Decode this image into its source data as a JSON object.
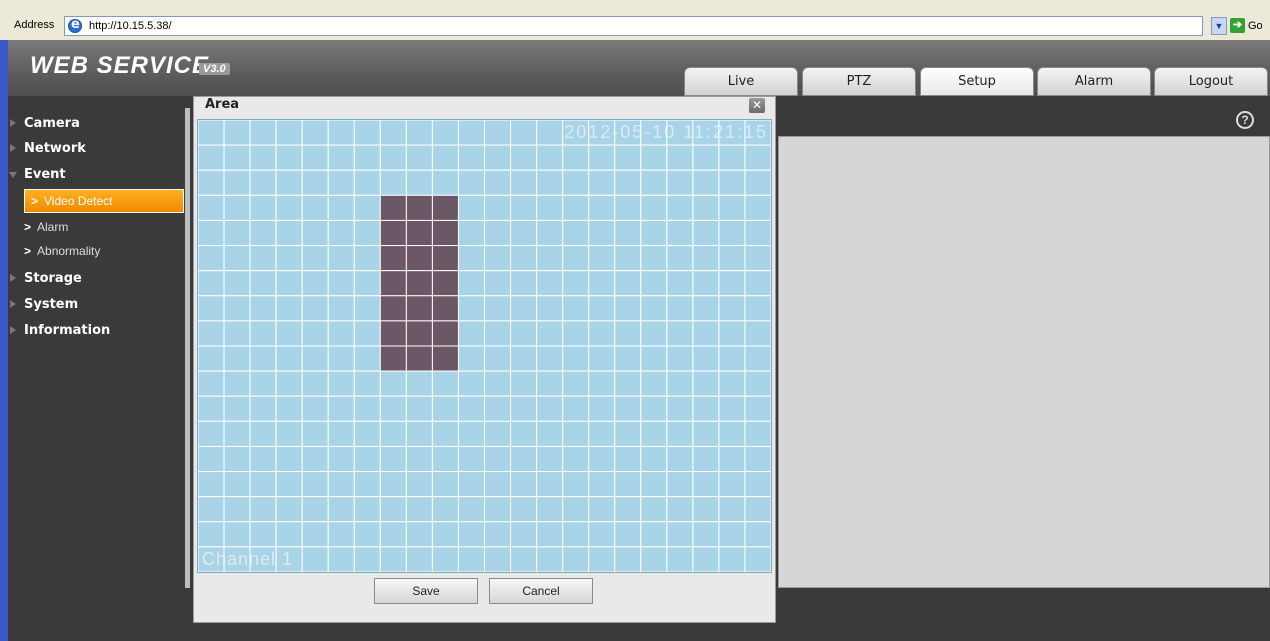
{
  "browser": {
    "address_label": "Address",
    "url": "http://10.15.5.38/",
    "go_label": "Go",
    "ie_icon": "ie-icon",
    "go_icon": "go-arrow-icon"
  },
  "app": {
    "logo": "WEB  SERVICE",
    "logo_version": "V3.0"
  },
  "tabs": [
    {
      "label": "Live"
    },
    {
      "label": "PTZ"
    },
    {
      "label": "Setup",
      "active": true
    },
    {
      "label": "Alarm"
    },
    {
      "label": "Logout"
    }
  ],
  "sidebar": {
    "items": [
      {
        "label": "Camera"
      },
      {
        "label": "Network"
      },
      {
        "label": "Event",
        "expanded": true
      },
      {
        "label": "Storage"
      },
      {
        "label": "System"
      },
      {
        "label": "Information"
      }
    ],
    "event_subitems": [
      {
        "label": "Video Detect",
        "selected": true
      },
      {
        "label": "Alarm"
      },
      {
        "label": "Abnormality"
      }
    ]
  },
  "dialog": {
    "title": "Area",
    "close_icon": "close-icon",
    "osd_time": "2012-05-10 11:21:15",
    "osd_channel": "Channel 1",
    "grid": {
      "columns": 22,
      "rows": 18,
      "selected_cells": {
        "col_start": 7,
        "col_end": 9,
        "row_start": 3,
        "row_end": 9
      }
    },
    "save_label": "Save",
    "cancel_label": "Cancel"
  },
  "colors": {
    "grid_cell": "#a9d4e8",
    "grid_line": "#ffffff",
    "selected_cell": "#6b5765",
    "active_nav": "#f59a10"
  },
  "help_icon": "help-icon"
}
